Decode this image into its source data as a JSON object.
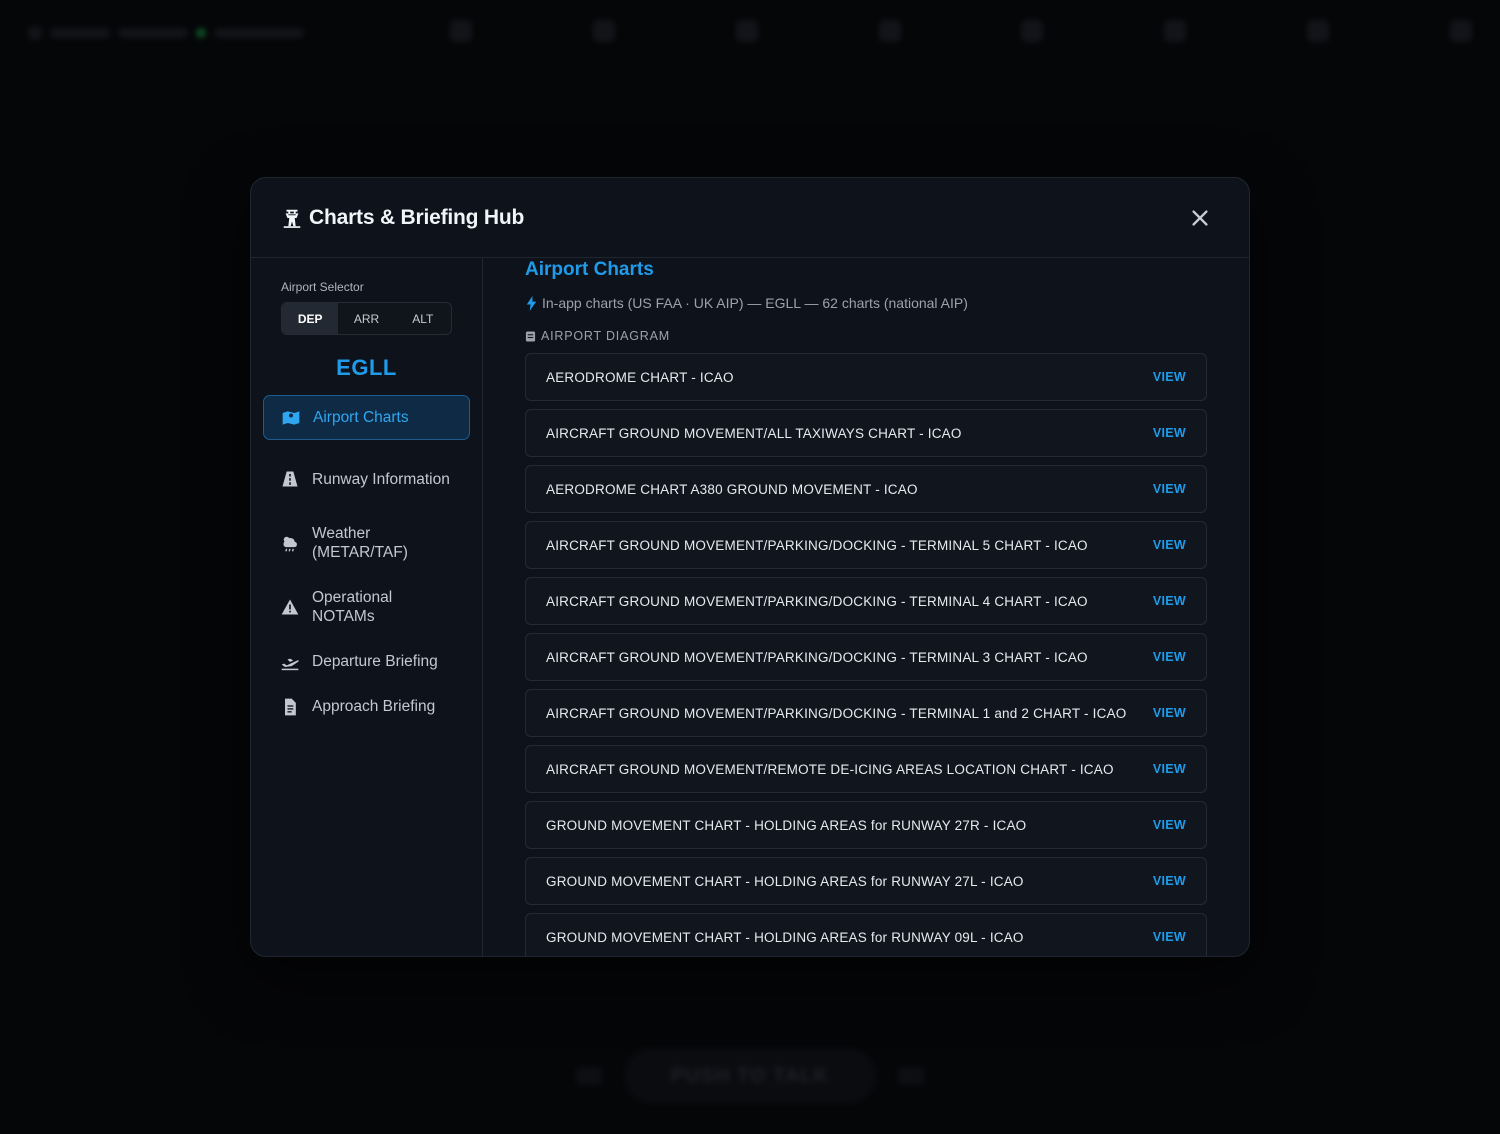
{
  "background": {
    "ptt_label": "PUSH TO TALK"
  },
  "modal": {
    "title": "Charts & Briefing Hub",
    "title_icon": "tower-icon",
    "close_icon": "close-icon"
  },
  "sidebar": {
    "selector_label": "Airport Selector",
    "segments": [
      "DEP",
      "ARR",
      "ALT"
    ],
    "active_segment": "DEP",
    "airport_code": "EGLL",
    "items": [
      {
        "label": "Airport Charts",
        "icon": "map-icon",
        "active": true
      },
      {
        "label": "Runway Information",
        "icon": "road-icon"
      },
      {
        "label": "Weather (METAR/TAF)",
        "icon": "cloud-sun-rain-icon"
      },
      {
        "label": "Operational NOTAMs",
        "icon": "warning-icon"
      },
      {
        "label": "Departure Briefing",
        "icon": "plane-departure-icon"
      },
      {
        "label": "Approach Briefing",
        "icon": "document-icon"
      }
    ]
  },
  "main": {
    "title": "Airport Charts",
    "subline": "In-app charts (US FAA · UK AIP) — EGLL — 62 charts (national AIP)",
    "category": "AIRPORT DIAGRAM",
    "view_label": "VIEW",
    "charts": [
      "AERODROME CHART - ICAO",
      "AIRCRAFT GROUND MOVEMENT/ALL TAXIWAYS CHART - ICAO",
      "AERODROME CHART A380 GROUND MOVEMENT - ICAO",
      "AIRCRAFT GROUND MOVEMENT/PARKING/DOCKING - TERMINAL 5 CHART - ICAO",
      "AIRCRAFT GROUND MOVEMENT/PARKING/DOCKING - TERMINAL 4 CHART - ICAO",
      "AIRCRAFT GROUND MOVEMENT/PARKING/DOCKING - TERMINAL 3 CHART - ICAO",
      "AIRCRAFT GROUND MOVEMENT/PARKING/DOCKING - TERMINAL 1 and 2 CHART - ICAO",
      "AIRCRAFT GROUND MOVEMENT/REMOTE DE-ICING AREAS LOCATION CHART - ICAO",
      "GROUND MOVEMENT CHART - HOLDING AREAS for RUNWAY 27R - ICAO",
      "GROUND MOVEMENT CHART - HOLDING AREAS for RUNWAY 27L - ICAO",
      "GROUND MOVEMENT CHART - HOLDING AREAS for RUNWAY 09L - ICAO"
    ]
  },
  "colors": {
    "accent": "#1f9bea",
    "background": "#050608",
    "panel": "#0e131b"
  }
}
